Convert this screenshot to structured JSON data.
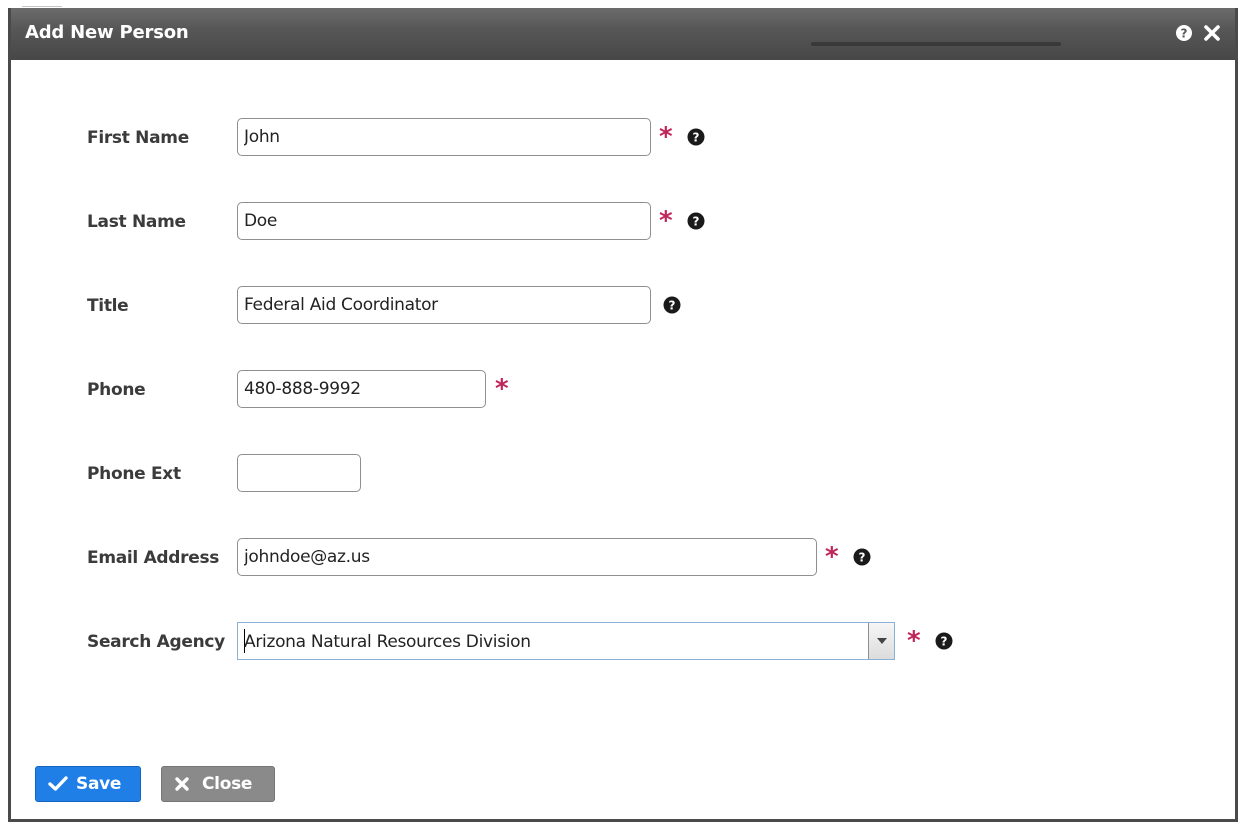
{
  "dialog": {
    "title": "Add New Person",
    "help_icon": "question-circle-icon",
    "close_icon": "close-x-icon"
  },
  "form": {
    "required_marker": "*",
    "fields": {
      "first_name": {
        "label": "First Name",
        "value": "John"
      },
      "last_name": {
        "label": "Last Name",
        "value": "Doe"
      },
      "title": {
        "label": "Title",
        "value": "Federal Aid Coordinator"
      },
      "phone": {
        "label": "Phone",
        "value": "480-888-9992"
      },
      "phone_ext": {
        "label": "Phone Ext",
        "value": ""
      },
      "email": {
        "label": "Email Address",
        "value": "johndoe@az.us"
      },
      "agency": {
        "label": "Search Agency",
        "value": "Arizona Natural Resources Division"
      }
    }
  },
  "actions": {
    "save_label": "Save",
    "close_label": "Close"
  },
  "colors": {
    "titlebar": "#575757",
    "required": "#c0265a",
    "save_button": "#1f7fe6",
    "close_button": "#8a8a8a"
  }
}
